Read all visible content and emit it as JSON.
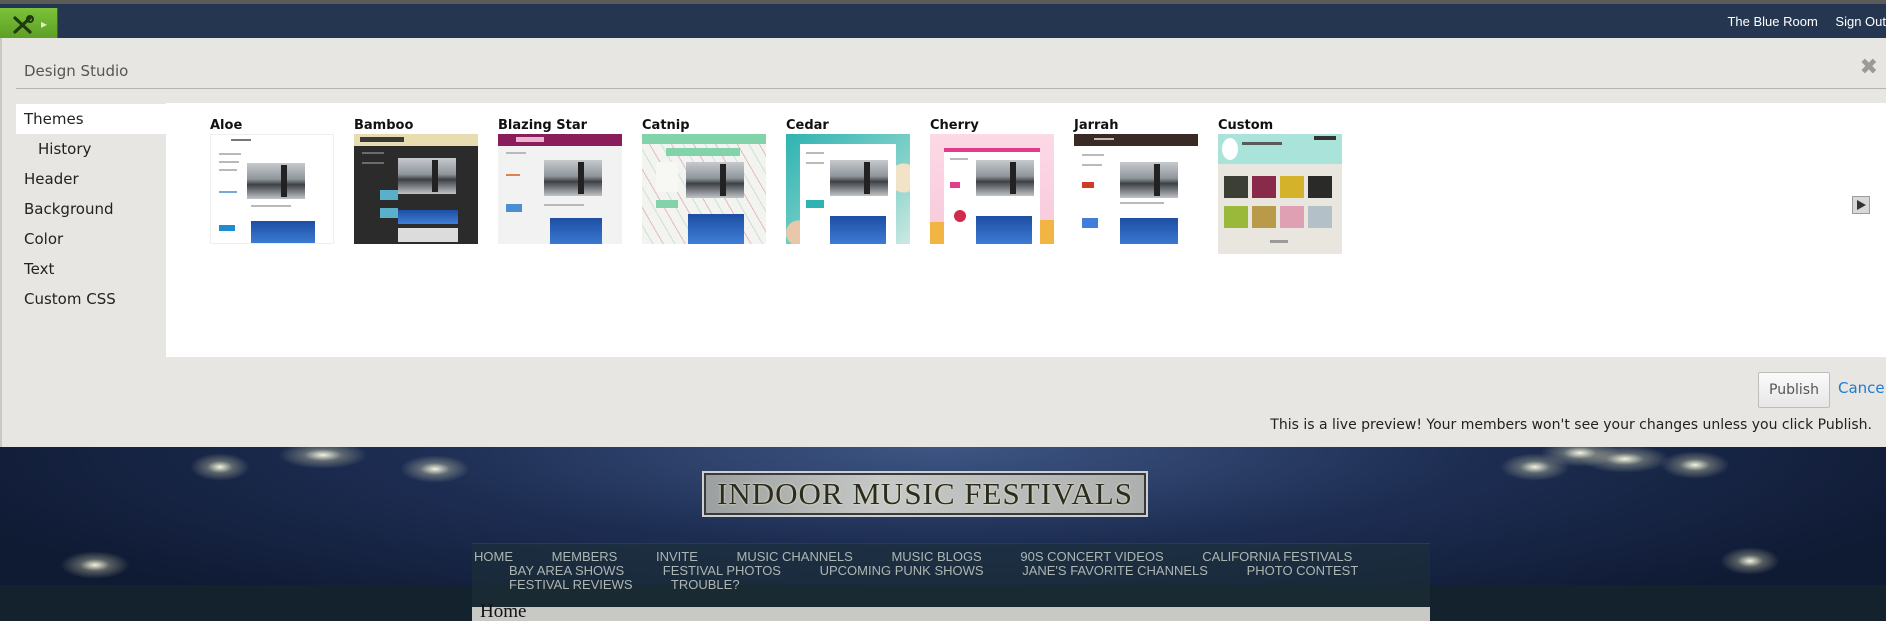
{
  "topbar": {
    "tools_icon": "tools-icon",
    "expand_icon": "chevron-right-icon",
    "links": [
      "The Blue Room",
      "Sign Out"
    ]
  },
  "studio": {
    "title": "Design Studio",
    "close_icon": "close-icon",
    "nav": [
      {
        "label": "Themes",
        "active": true,
        "sub": false
      },
      {
        "label": "History",
        "active": false,
        "sub": true
      },
      {
        "label": "Header",
        "active": false,
        "sub": false
      },
      {
        "label": "Background",
        "active": false,
        "sub": false
      },
      {
        "label": "Color",
        "active": false,
        "sub": false
      },
      {
        "label": "Text",
        "active": false,
        "sub": false
      },
      {
        "label": "Custom CSS",
        "active": false,
        "sub": false
      }
    ],
    "themes": [
      {
        "name": "Aloe",
        "accent": "#ffffff"
      },
      {
        "name": "Bamboo",
        "accent": "#2a2a2a"
      },
      {
        "name": "Blazing Star",
        "accent": "#8c1d5b"
      },
      {
        "name": "Catnip",
        "accent": "#7fd1a6"
      },
      {
        "name": "Cedar",
        "accent": "#2bb2b5"
      },
      {
        "name": "Cherry",
        "accent": "#e23d8a"
      },
      {
        "name": "Jarrah",
        "accent": "#3a2a26"
      },
      {
        "name": "Custom",
        "accent": "#a9e3da"
      }
    ],
    "next_icon": "next-arrow-icon",
    "publish_label": "Publish",
    "cancel_label": "Cancel",
    "preview_note": "This is a live preview! Your members won't see your changes unless you click Publish."
  },
  "site": {
    "title": "INDOOR MUSIC FESTIVALS",
    "nav_row1": [
      "HOME",
      "MEMBERS",
      "INVITE",
      "MUSIC CHANNELS",
      "MUSIC BLOGS",
      "90S CONCERT VIDEOS",
      "CALIFORNIA FESTIVALS"
    ],
    "nav_row2": [
      "BAY AREA SHOWS",
      "FESTIVAL PHOTOS",
      "UPCOMING PUNK SHOWS",
      "JANE'S FAVORITE CHANNELS",
      "PHOTO CONTEST"
    ],
    "nav_row3": [
      "FESTIVAL REVIEWS",
      "TROUBLE?"
    ],
    "page_heading": "Home"
  }
}
